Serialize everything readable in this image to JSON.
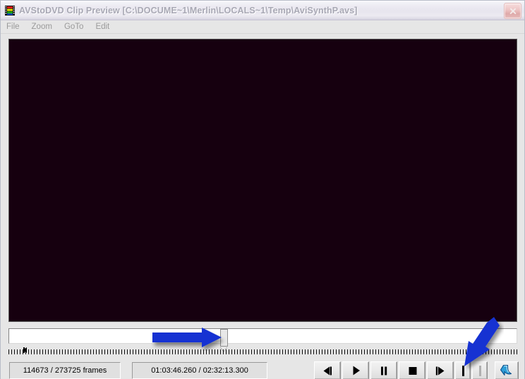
{
  "window": {
    "title": "AVStoDVD Clip Preview [C:\\DOCUME~1\\Merlin\\LOCALS~1\\Temp\\AviSynthP.avs]",
    "icon": "film-strip-icon",
    "close_label": "Close",
    "video_background_color": "#16000f",
    "titlebar_state": "inactive"
  },
  "menu": {
    "items": [
      {
        "label": "File",
        "name": "menu-file",
        "enabled": false
      },
      {
        "label": "Zoom",
        "name": "menu-zoom",
        "enabled": false
      },
      {
        "label": "GoTo",
        "name": "menu-goto",
        "enabled": false
      },
      {
        "label": "Edit",
        "name": "menu-edit",
        "enabled": false
      }
    ]
  },
  "seek": {
    "position_percent": 41.9,
    "thumb_label": "seek-thumb",
    "marker_position_percent": 1.2
  },
  "status": {
    "frames": "114673 / 273725  frames",
    "current_frame": 114673,
    "total_frames": 273725,
    "time": "01:03:46.260 / 02:32:13.300",
    "current_time": "01:03:46.260",
    "total_time": "02:32:13.300"
  },
  "transport": {
    "buttons": [
      {
        "name": "previous-frame-button",
        "icon": "step-backward-icon",
        "tooltip": "Previous Frame"
      },
      {
        "name": "play-button",
        "icon": "play-icon",
        "tooltip": "Play"
      },
      {
        "name": "pause-button",
        "icon": "pause-icon",
        "tooltip": "Pause"
      },
      {
        "name": "stop-button",
        "icon": "stop-icon",
        "tooltip": "Stop"
      },
      {
        "name": "next-frame-button",
        "icon": "step-forward-icon",
        "tooltip": "Next Frame"
      },
      {
        "name": "mark-in-button",
        "icon": "mark-in-icon",
        "tooltip": "Set Start",
        "enabled": true
      },
      {
        "name": "mark-out-button",
        "icon": "mark-out-icon",
        "tooltip": "Set End",
        "enabled": false
      },
      {
        "name": "jump-button",
        "icon": "blue-curved-arrow-icon",
        "tooltip": "Apply / Return"
      }
    ]
  },
  "annotations": {
    "arrow_color": "#1432d2",
    "items": [
      {
        "name": "annotation-arrow-to-seek-thumb",
        "points_to": "seek-thumb",
        "direction": "right"
      },
      {
        "name": "annotation-arrow-to-mark-in",
        "points_to": "mark-in-button",
        "direction": "down-left"
      }
    ]
  }
}
